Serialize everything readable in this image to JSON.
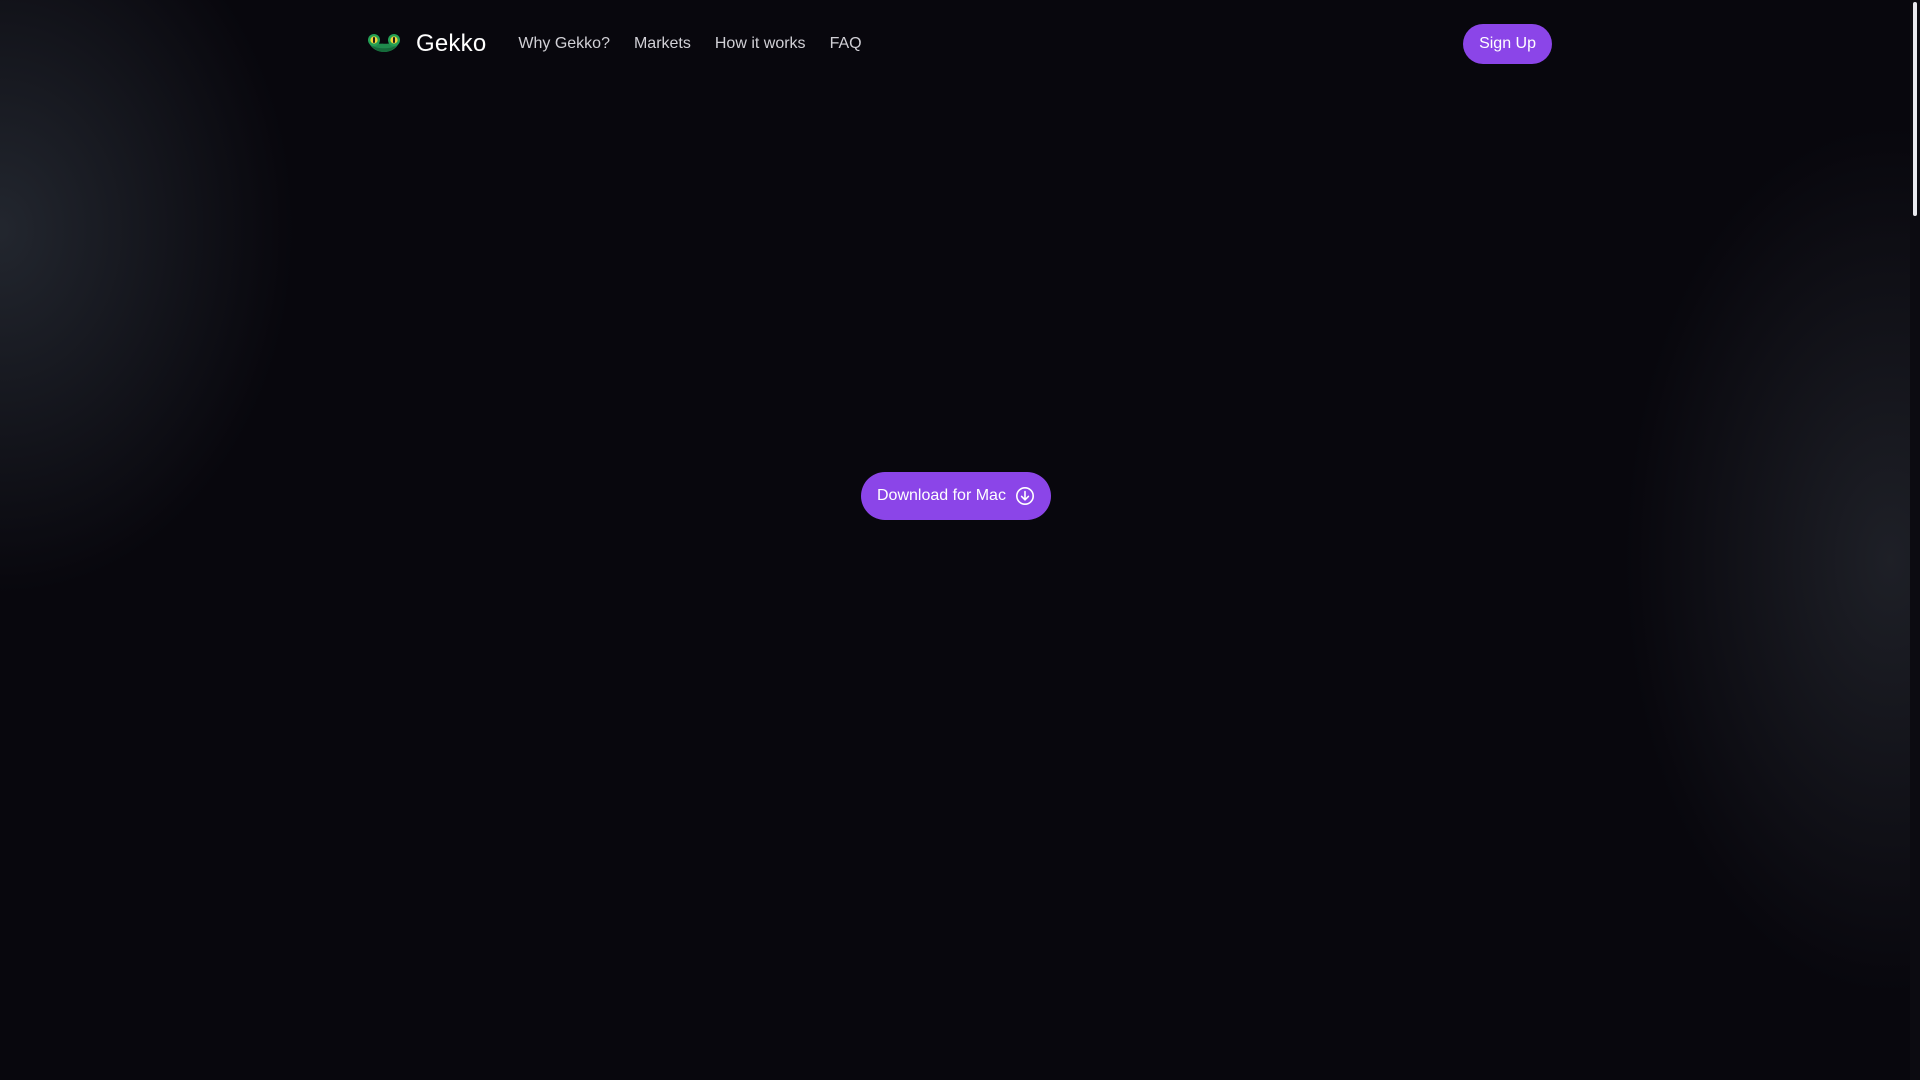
{
  "header": {
    "brand": "Gekko",
    "logo_icon": "gekko-head-icon",
    "nav": [
      {
        "label": "Why Gekko?"
      },
      {
        "label": "Markets"
      },
      {
        "label": "How it works"
      },
      {
        "label": "FAQ"
      }
    ],
    "signup_label": "Sign Up"
  },
  "hero": {
    "download_label": "Download for Mac",
    "download_icon": "download-circle-icon"
  },
  "colors": {
    "background": "#08070d",
    "accent": "#8b45e8",
    "nav_text": "#d1d0d6"
  }
}
